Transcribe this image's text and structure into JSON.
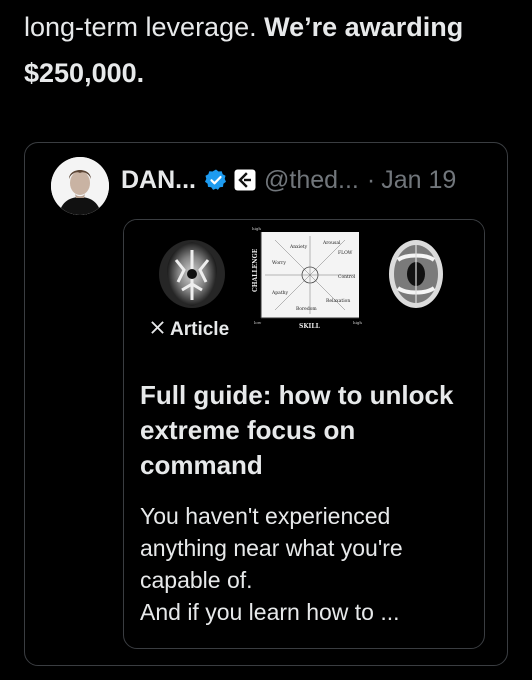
{
  "post": {
    "text_regular": "long-term leverage. ",
    "text_bold": "We’re awarding $250,000."
  },
  "quoted_post": {
    "author_name": "DAN...",
    "handle": "@thed...",
    "separator": "·",
    "date": "Jan 19",
    "avatar_icon": "portrait-avatar",
    "verified_icon": "verified-badge-icon",
    "verified_color": "#1d9bf0",
    "affiliate_icon": "affiliate-badge-icon"
  },
  "article": {
    "badge_label": "Article",
    "badge_icon": "x-logo-icon",
    "title": "Full guide: how to unlock extreme focus on command",
    "excerpt": "You haven't experienced anything near what you're capable of.\nAnd if you learn how to ...",
    "cover": {
      "y_axis_label": "CHALLENGE",
      "x_axis_label": "SKILL",
      "y_high": "high",
      "y_low": "low",
      "x_high": "high",
      "states": [
        "Arousal",
        "FLOW",
        "Anxiety",
        "Worry",
        "Control",
        "Apathy",
        "Boredom",
        "Relaxation"
      ]
    }
  },
  "colors": {
    "background": "#000000",
    "text": "#e7e9ea",
    "muted": "#71767b",
    "border": "#3a3d41"
  }
}
